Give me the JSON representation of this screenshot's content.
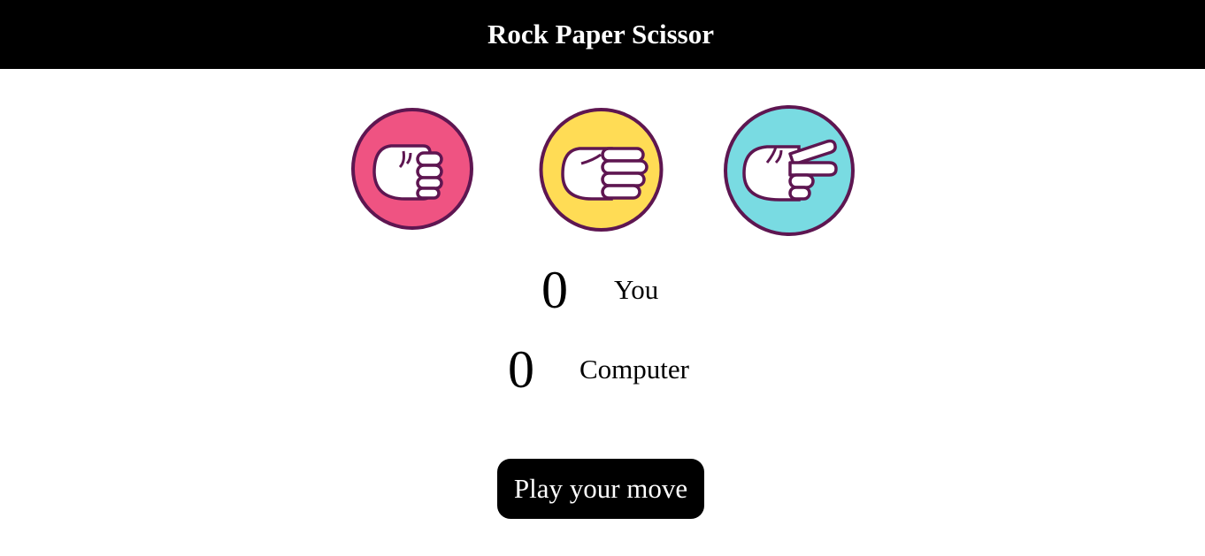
{
  "header": {
    "title": "Rock Paper Scissor"
  },
  "choices": [
    {
      "name": "rock",
      "color": "#ef5382"
    },
    {
      "name": "paper",
      "color": "#ffdc55"
    },
    {
      "name": "scissor",
      "color": "#79dbe2"
    }
  ],
  "outline_color": "#5e1651",
  "scoreboard": {
    "user": {
      "score": "0",
      "label": "You"
    },
    "computer": {
      "score": "0",
      "label": "Computer"
    }
  },
  "action": {
    "play_label": "Play your move"
  }
}
